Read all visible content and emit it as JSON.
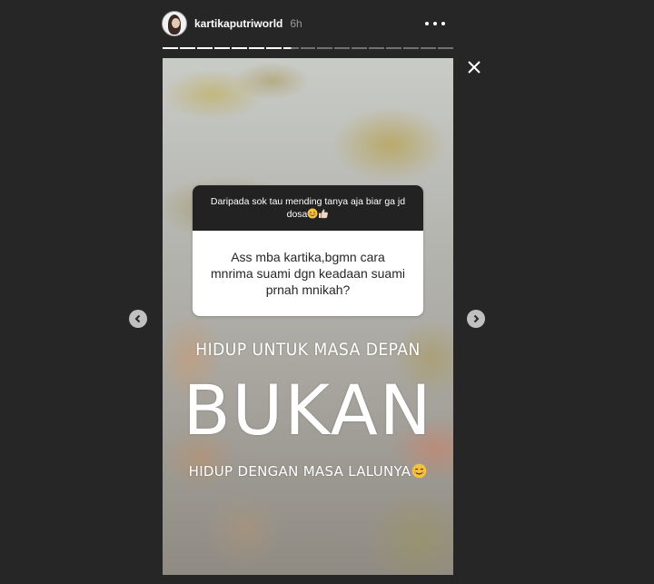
{
  "header": {
    "username": "kartikaputriworld",
    "time": "6h"
  },
  "progress": {
    "total_segments": 17,
    "completed_segments": 7,
    "current_segment_fraction": 0.5
  },
  "question_box": {
    "prompt": "Daripada sok tau mending tanya aja biar ga jd dosa",
    "prompt_emojis": [
      "smiling-face-emoji",
      "thumbs-up-emoji"
    ],
    "answer": "Ass mba kartika,bgmn cara mnrima suami dgn keadaan suami prnah mnikah?"
  },
  "overlay_text": {
    "line1": "HIDUP UNTUK MASA DEPAN",
    "line2": "BUKAN",
    "line3": "HIDUP DENGAN MASA LALUNYA",
    "line3_emoji": "smiling-face-emoji"
  },
  "icons": {
    "more": "more-options-icon",
    "close": "close-icon",
    "prev": "chevron-left-icon",
    "next": "chevron-right-icon"
  },
  "colors": {
    "background": "#262626",
    "question_header": "#222222",
    "question_body": "#ffffff"
  }
}
